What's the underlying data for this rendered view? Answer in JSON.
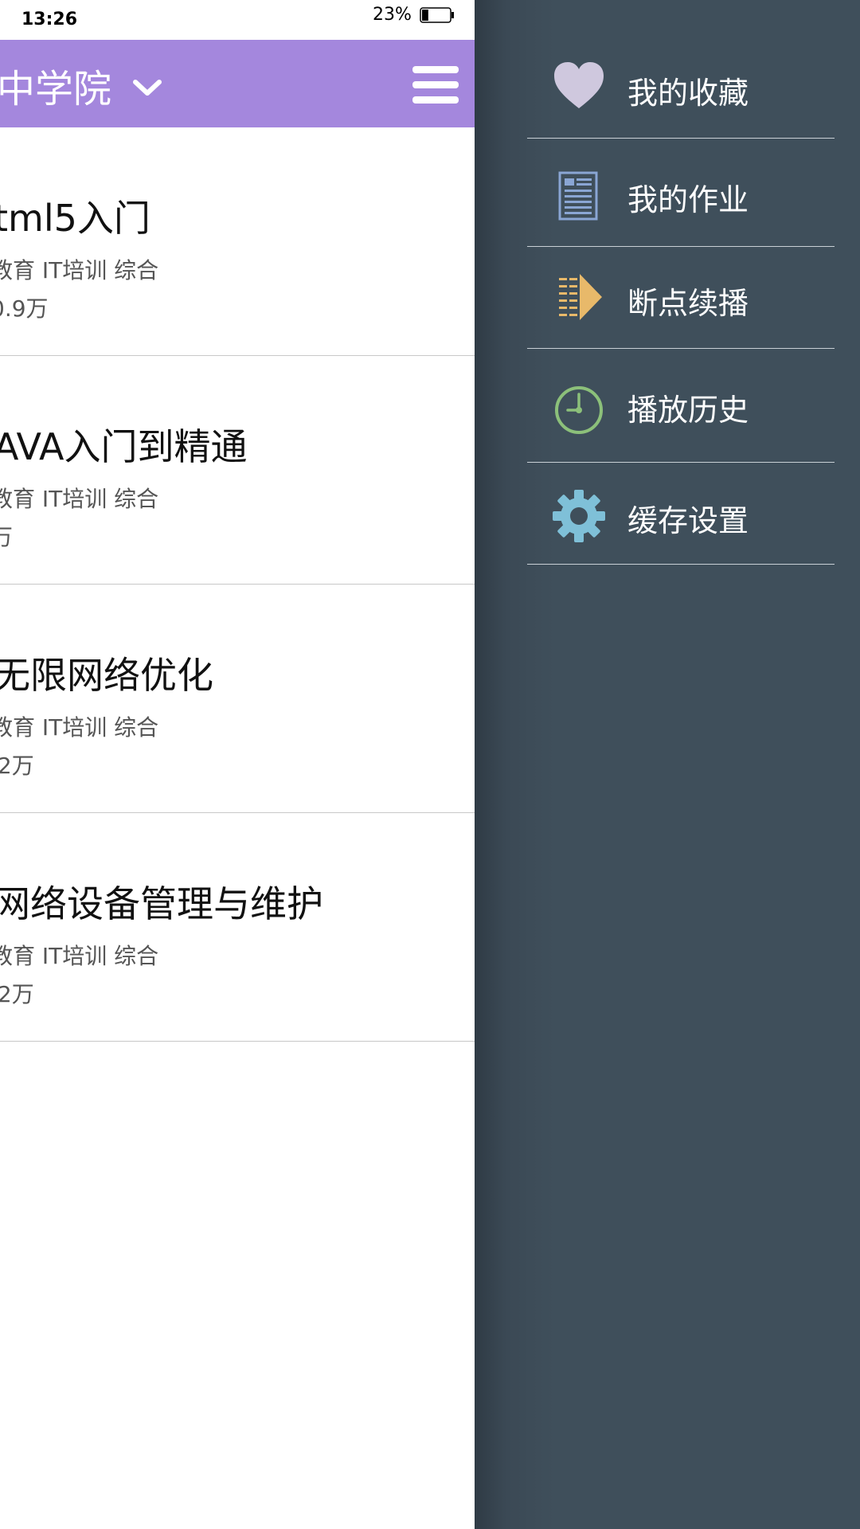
{
  "status_bar": {
    "time": "13:26",
    "battery": "23%",
    "battery_level": 0.23
  },
  "header": {
    "title": "中学院",
    "chevron_icon": "chevron-down-icon",
    "menu_icon": "hamburger-menu-icon"
  },
  "courses": [
    {
      "title": "tml5入门",
      "tags": "教育 IT培训 综合",
      "views": "0.9万"
    },
    {
      "title": "AVA入门到精通",
      "tags": "教育 IT培训 综合",
      "views": "万"
    },
    {
      "title": "无限网络优化",
      "tags": "教育 IT培训 综合",
      "views": ".2万"
    },
    {
      "title": "网络设备管理与维护",
      "tags": "教育 IT培训 综合",
      "views": ".2万"
    }
  ],
  "drawer": {
    "items": [
      {
        "label": "我的收藏",
        "icon": "heart-icon",
        "color": "#cfc8de"
      },
      {
        "label": "我的作业",
        "icon": "document-icon",
        "color": "#8aa6d4"
      },
      {
        "label": "断点续播",
        "icon": "resume-play-icon",
        "color": "#e8b96a"
      },
      {
        "label": "播放历史",
        "icon": "clock-icon",
        "color": "#8cc07a"
      },
      {
        "label": "缓存设置",
        "icon": "gear-icon",
        "color": "#7fc0d8"
      }
    ]
  },
  "colors": {
    "header_bg": "#a487dd",
    "drawer_bg": "#3f4f5b",
    "divider": "#c8c8c8"
  }
}
